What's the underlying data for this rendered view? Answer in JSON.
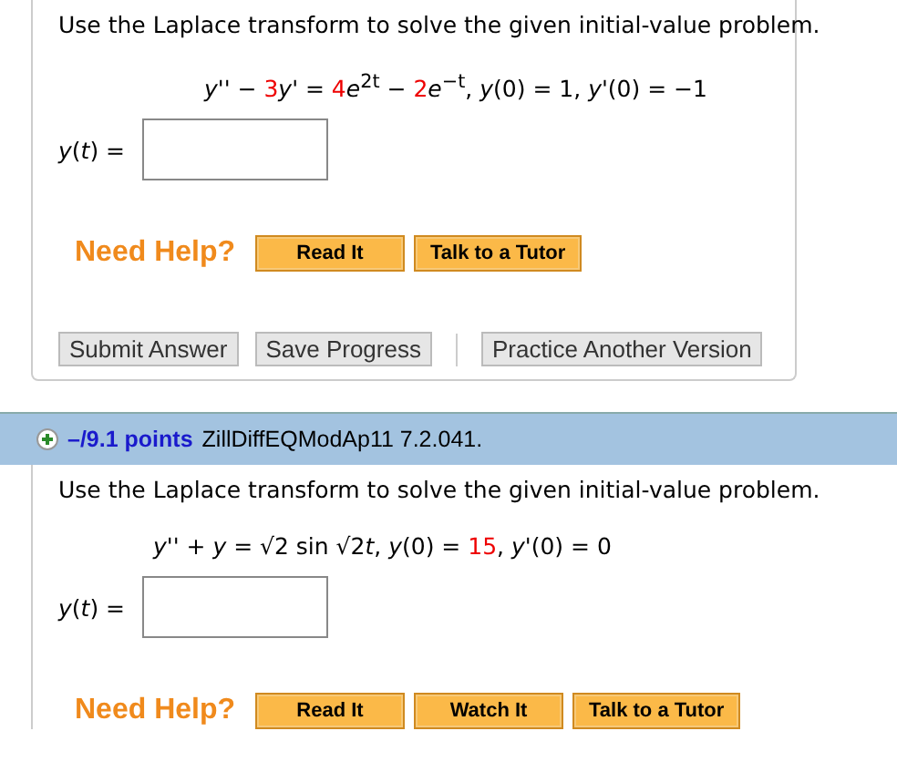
{
  "problems": [
    {
      "prompt": "Use the Laplace transform to solve the given initial-value problem.",
      "equation": [
        {
          "text": "*y*'' − ",
          "red": false
        },
        {
          "text": "3",
          "red": true
        },
        {
          "text": "*y*' = ",
          "red": false
        },
        {
          "text": "4",
          "red": true
        },
        {
          "text": "*e*$^{2t}$",
          "red": false
        },
        {
          "text": " − ",
          "red": false
        },
        {
          "text": "2",
          "red": true
        },
        {
          "text": "*e*$^{−t}$,    *y*(0) = 1, *y*'(0) = −1",
          "red": false
        }
      ],
      "answer_label": "*y*(*t*) =",
      "help_label": "Need Help?",
      "help_buttons": [
        "Read It",
        "Talk to a Tutor"
      ],
      "actions": [
        {
          "label": "Submit Answer",
          "separator_before": false
        },
        {
          "label": "Save Progress",
          "separator_before": false
        },
        {
          "label": "Practice Another Version",
          "separator_before": true
        }
      ]
    },
    {
      "header": {
        "points": "–/9.1 points",
        "source": "ZillDiffEQModAp11 7.2.041."
      },
      "prompt": "Use the Laplace transform to solve the given initial-value problem.",
      "equation": [
        {
          "text": "*y*'' + *y* = √2 sin √2",
          "red": false
        },
        {
          "text": "*t*,  *y*(0) = ",
          "red": false
        },
        {
          "text": "15",
          "red": true
        },
        {
          "text": ",  *y*'(0) = 0",
          "red": false
        }
      ],
      "answer_label": "*y*(*t*) =",
      "help_label": "Need Help?",
      "help_buttons": [
        "Read It",
        "Watch It",
        "Talk to a Tutor"
      ]
    }
  ]
}
